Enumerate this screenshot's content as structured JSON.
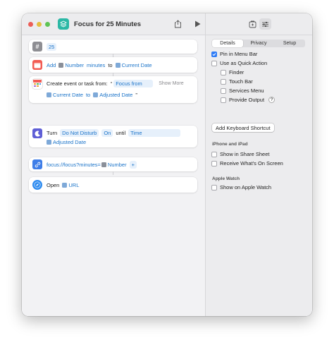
{
  "window": {
    "title": "Focus for 25 Minutes"
  },
  "actions": {
    "number": {
      "value": "25"
    },
    "adjust_date": {
      "add_label": "Add",
      "number_var": "Number",
      "unit": "minutes",
      "to_label": "to",
      "date_var": "Current Date"
    },
    "create_event": {
      "label": "Create event or task from:",
      "open_quote": "“",
      "title_token": "Focus from",
      "show_more": "Show More",
      "start_var": "Current Date",
      "to_label": "to",
      "end_var": "Adjusted Date",
      "close_quote": "”"
    },
    "dnd": {
      "turn_label": "Turn",
      "mode": "Do Not Disturb",
      "state": "On",
      "until_label": "until",
      "time_token": "Time",
      "date_var": "Adjusted Date"
    },
    "url": {
      "text": "focus://focus?minutes=",
      "number_var": "Number",
      "plus": "+"
    },
    "open_url": {
      "open_label": "Open",
      "url_var": "URL"
    }
  },
  "sidebar": {
    "tabs": [
      "Details",
      "Privacy",
      "Setup"
    ],
    "active_tab": "Details",
    "options": {
      "pin_menu_bar": {
        "label": "Pin in Menu Bar",
        "checked": true
      },
      "quick_action": {
        "label": "Use as Quick Action",
        "checked": false
      },
      "finder": {
        "label": "Finder",
        "checked": false
      },
      "touch_bar": {
        "label": "Touch Bar",
        "checked": false
      },
      "services_menu": {
        "label": "Services Menu",
        "checked": false
      },
      "provide_output": {
        "label": "Provide Output",
        "checked": false,
        "help": "?"
      }
    },
    "keyboard_shortcut_button": "Add Keyboard Shortcut",
    "iphone_section": {
      "title": "iPhone and iPad",
      "share_sheet": "Show in Share Sheet",
      "whats_on_screen": "Receive What's On Screen"
    },
    "watch_section": {
      "title": "Apple Watch",
      "show_on_watch": "Show on Apple Watch"
    }
  },
  "colors": {
    "accent": "#2f7cf6",
    "token_text": "#1a73c9",
    "app_icon": "#2bb8a5"
  }
}
